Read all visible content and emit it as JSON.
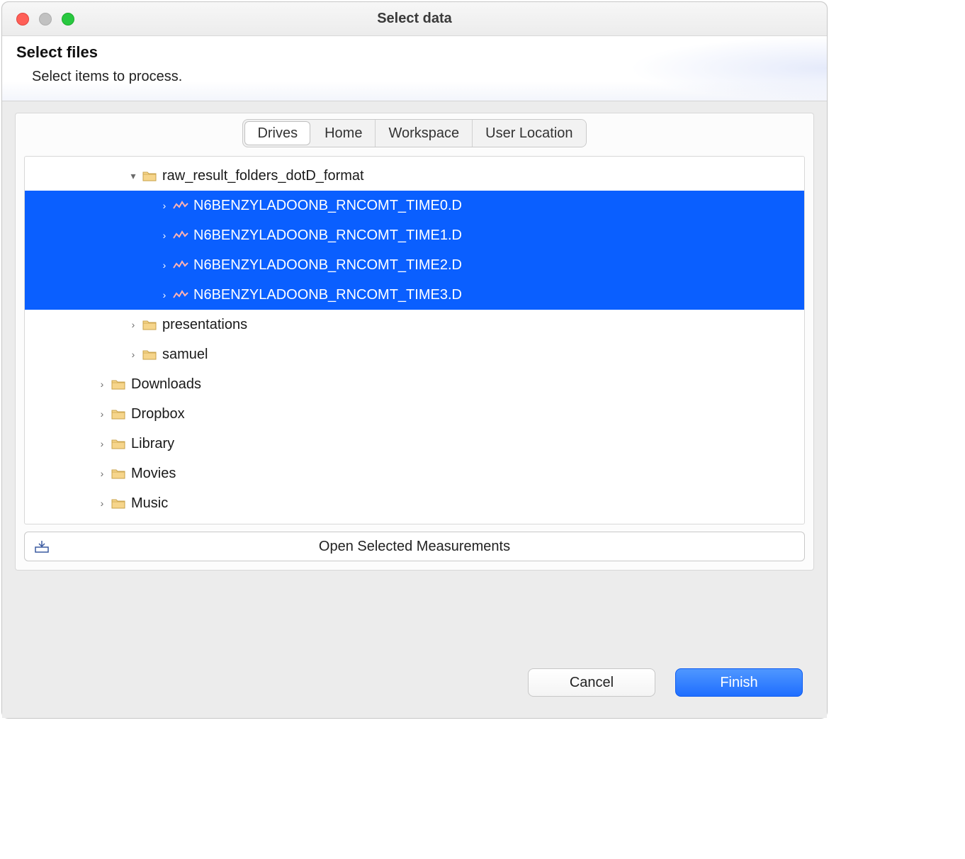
{
  "window": {
    "title": "Select data"
  },
  "header": {
    "title": "Select files",
    "subtitle": "Select items to process."
  },
  "tabs": {
    "drives": "Drives",
    "home": "Home",
    "workspace": "Workspace",
    "user_location": "User Location",
    "active": "drives"
  },
  "tree": {
    "rows": [
      {
        "indent": 3,
        "expanded": true,
        "icon": "folder",
        "label": "raw_result_folders_dotD_format",
        "selected": false
      },
      {
        "indent": 4,
        "expanded": false,
        "icon": "data",
        "label": "N6BENZYLADOONB_RNCOMT_TIME0.D",
        "selected": true
      },
      {
        "indent": 4,
        "expanded": false,
        "icon": "data",
        "label": "N6BENZYLADOONB_RNCOMT_TIME1.D",
        "selected": true
      },
      {
        "indent": 4,
        "expanded": false,
        "icon": "data",
        "label": "N6BENZYLADOONB_RNCOMT_TIME2.D",
        "selected": true
      },
      {
        "indent": 4,
        "expanded": false,
        "icon": "data",
        "label": "N6BENZYLADOONB_RNCOMT_TIME3.D",
        "selected": true
      },
      {
        "indent": 3,
        "expanded": false,
        "icon": "folder",
        "label": "presentations",
        "selected": false
      },
      {
        "indent": 3,
        "expanded": false,
        "icon": "folder",
        "label": "samuel",
        "selected": false
      },
      {
        "indent": 2,
        "expanded": false,
        "icon": "folder",
        "label": "Downloads",
        "selected": false
      },
      {
        "indent": 2,
        "expanded": false,
        "icon": "folder",
        "label": "Dropbox",
        "selected": false
      },
      {
        "indent": 2,
        "expanded": false,
        "icon": "folder",
        "label": "Library",
        "selected": false
      },
      {
        "indent": 2,
        "expanded": false,
        "icon": "folder",
        "label": "Movies",
        "selected": false
      },
      {
        "indent": 2,
        "expanded": false,
        "icon": "folder",
        "label": "Music",
        "selected": false
      }
    ]
  },
  "open_button": {
    "label": "Open Selected Measurements"
  },
  "footer": {
    "cancel": "Cancel",
    "finish": "Finish"
  }
}
